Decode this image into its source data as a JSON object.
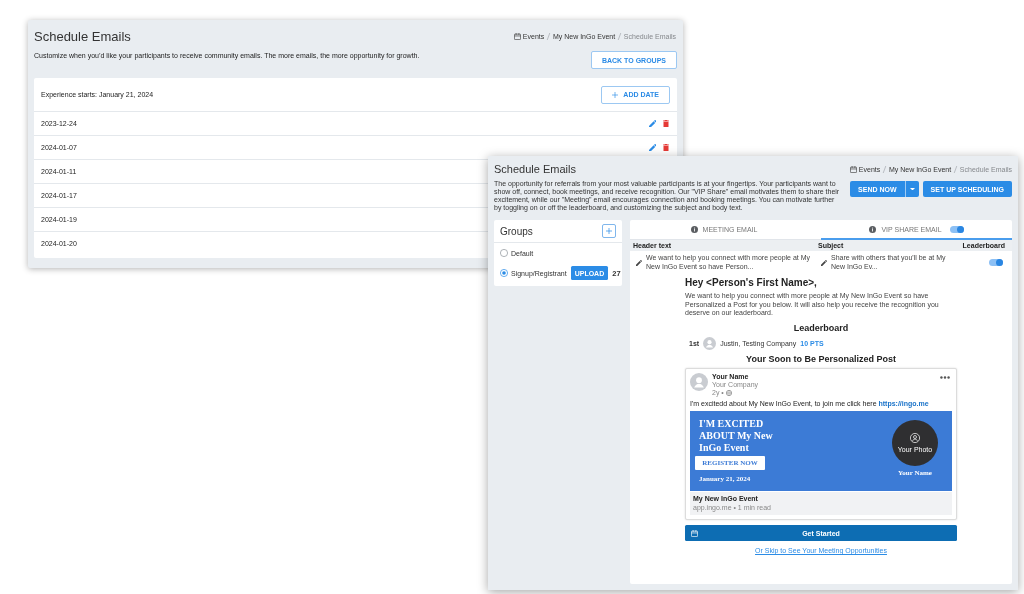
{
  "dates_window": {
    "title": "Schedule Emails",
    "breadcrumb": [
      {
        "label": "Events",
        "current": false
      },
      {
        "label": "My New InGo Event",
        "current": false
      },
      {
        "label": "Schedule Emails",
        "current": true
      }
    ],
    "description": "Customize when you’d like your participants to receive community emails. The more emails, the more opportunity for growth.",
    "back_button": "BACK TO GROUPS",
    "experience_start": "Experience starts: January 21, 2024",
    "add_date_button": "ADD DATE",
    "dates": [
      "2023-12-24",
      "2024-01-07",
      "2024-01-11",
      "2024-01-17",
      "2024-01-19",
      "2024-01-20"
    ]
  },
  "emails_window": {
    "title": "Schedule Emails",
    "breadcrumb": [
      {
        "label": "Events",
        "current": false
      },
      {
        "label": "My New InGo Event",
        "current": false
      },
      {
        "label": "Schedule Emails",
        "current": true
      }
    ],
    "description": "The opportunity for referrals from your most valuable participants is at your fingertips. Your participants want to show off, connect, book meetings, and receive recognition. Our \"VIP Share\" email motivates them to share their excitement, while our \"Meeting\" email encourages connection and booking meetings. You can motivate further by toggling on or off the leaderboard, and customizing the subject and body text.",
    "send_button": "SEND NOW",
    "schedule_button": "SET UP SCHEDULING",
    "groups": {
      "title": "Groups",
      "items": [
        {
          "label": "Default",
          "selected": false
        },
        {
          "label": "Signup/Registrant",
          "selected": true,
          "upload_button": "UPLOAD",
          "count": "27"
        }
      ]
    },
    "tabs": [
      {
        "label": "MEETING EMAIL",
        "selected": false,
        "kind": "plain"
      },
      {
        "label": "VIP SHARE EMAIL",
        "selected": true,
        "kind": "toggle",
        "on": true
      }
    ],
    "table": {
      "columns": [
        "Header text",
        "Subject",
        "Leaderboard"
      ],
      "rows": [
        {
          "header_text": "We want to help you connect with more people at My New InGo Event so have Person...",
          "subject": "Share with others that you'll be at My New InGo Ev...",
          "leaderboard_on": true
        }
      ]
    },
    "preview": {
      "greeting": "Hey <Person's First Name>,",
      "intro": "We want to help you connect with more people at My New InGo Event so have Personalized a Post for you below. It will also help you receive the recognition you deserve on our leaderboard.",
      "leaderboard_title": "Leaderboard",
      "leaders": [
        {
          "rank": "1st",
          "name": "Justin, Testing Company",
          "points": "10 PTS"
        }
      ],
      "post_title": "Your Soon to Be Personalized Post",
      "post": {
        "author": "Your Name",
        "company": "Your Company",
        "age": "2y •",
        "text": "I'm excitedd about My New InGo Event, to join me click here",
        "link": "https://ingo.me",
        "banner": {
          "headline": [
            "I'M EXCITED",
            "ABOUT My New",
            "InGo Event"
          ],
          "button": "REGISTER NOW",
          "date": "January 21, 2024",
          "photo_label": "Your Photo",
          "name": "Your Name"
        },
        "link_title": "My New InGo Event",
        "link_meta": "app.ingo.me • 1 min read"
      },
      "cta_button": "Get Started",
      "skip_link": "Or Skip to See Your Meeting Opportunities"
    }
  }
}
